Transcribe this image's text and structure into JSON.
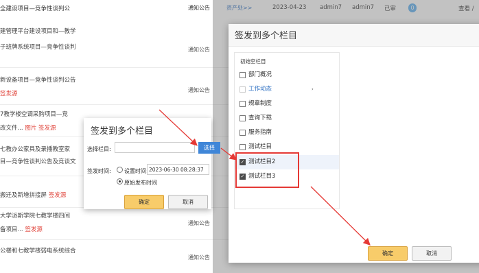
{
  "top_row": {
    "title": "全建设项目—竞争性谈判公",
    "type": "通知公告",
    "link": "资产处>>",
    "date": "2023-04-23",
    "author": "admin7",
    "reviewer": "admin7",
    "status": "已审",
    "count": "0",
    "action": "查看 /"
  },
  "list_rows": [
    {
      "line1": "建管理平台建设项目和—教学",
      "line2": "子班牌系统项目—竞争性谈判",
      "line2_red": "",
      "type": "通知公告"
    },
    {
      "line1": "新设备项目—竞争性谈判公告",
      "line2": "",
      "line2_red": "签发源",
      "type": "通知公告"
    },
    {
      "line1": "7教学楼空调采购项目—竞",
      "line2": "改文件... ",
      "line2_red": "图片 签发源",
      "type": ""
    },
    {
      "line1": "七教办公家具及录播教室家",
      "line2": "目—竞争性谈判公告及竞谈文",
      "line2_red": "",
      "type": ""
    },
    {
      "line1": "搬迁及新增拼接屏 ",
      "line2": "",
      "line2_red": "签发源",
      "type": ""
    },
    {
      "line1": "大学派斯学院七教学楼四间",
      "line2": "备项目... ",
      "line2_red": "签发源",
      "type": "通知公告"
    },
    {
      "line1": "公楼和七教学楼弱电系统综合",
      "line2": "",
      "line2_red": "",
      "type": "通知公告"
    }
  ],
  "big_dialog": {
    "title": "签发到多个栏目",
    "tree_header": "初始空栏目",
    "items": [
      {
        "label": "部门概况",
        "checked": false
      },
      {
        "label": "工作动态",
        "checked": false
      },
      {
        "label": "规章制度",
        "checked": false
      },
      {
        "label": "查询下载",
        "checked": false
      },
      {
        "label": "服务指南",
        "checked": false
      },
      {
        "label": "测试栏目",
        "checked": false
      },
      {
        "label": "测试栏目2",
        "checked": true
      },
      {
        "label": "测试栏目3",
        "checked": true
      }
    ],
    "expand_arrow": "›",
    "ok_label": "确定",
    "cancel_label": "取消"
  },
  "small_dialog": {
    "title": "签发到多个栏目",
    "select_label": "选择栏目:",
    "select_button": "选择",
    "time_label": "签发时间:",
    "set_time_label": "设置时间:",
    "time_value": "2023-06-30 08:28:37",
    "original_time_label": "原始发布时间",
    "ok_label": "确定",
    "cancel_label": "取消"
  },
  "colors": {
    "accent_blue": "#3f86d8",
    "ok_yellow": "#f8cc6a",
    "highlight_red": "#e53935"
  }
}
